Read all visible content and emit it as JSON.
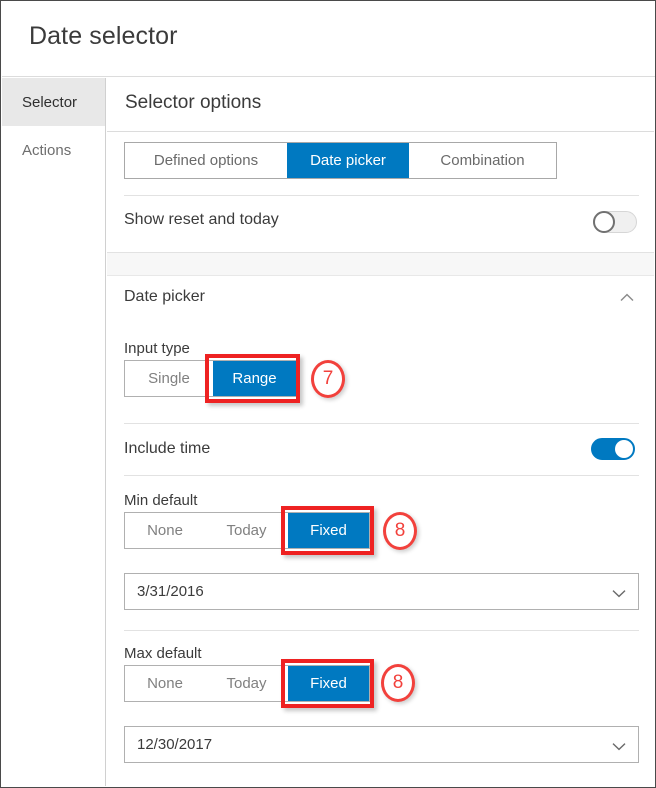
{
  "window": {
    "title": "Date selector"
  },
  "sidebar": {
    "items": [
      {
        "label": "Selector",
        "active": true
      },
      {
        "label": "Actions",
        "active": false
      }
    ]
  },
  "panel": {
    "header": "Selector options",
    "tabs": [
      {
        "label": "Defined options",
        "selected": false
      },
      {
        "label": "Date picker",
        "selected": true
      },
      {
        "label": "Combination",
        "selected": false
      }
    ],
    "show_reset_and_today": {
      "label": "Show reset and today",
      "value": "off"
    },
    "section": {
      "title": "Date picker",
      "collapse_icon": "chevron-up-icon",
      "expanded": true
    },
    "input_type": {
      "label": "Input type",
      "options": [
        "Single",
        "Range"
      ],
      "selected": "Range"
    },
    "include_time": {
      "label": "Include time",
      "value": "on"
    },
    "min_default": {
      "label": "Min default",
      "options": [
        "None",
        "Today",
        "Fixed"
      ],
      "selected": "Fixed",
      "date_value": "3/31/2016",
      "date_icon": "chevron-down-icon"
    },
    "max_default": {
      "label": "Max default",
      "options": [
        "None",
        "Today",
        "Fixed"
      ],
      "selected": "Fixed",
      "date_value": "12/30/2017",
      "date_icon": "chevron-down-icon"
    }
  },
  "annotations": [
    {
      "number": "7",
      "target": "input-type-range"
    },
    {
      "number": "8",
      "target": "min-default-fixed"
    },
    {
      "number": "8",
      "target": "max-default-fixed"
    }
  ],
  "colors": {
    "accent_blue": "#0079c1",
    "annotation_red": "#ee2222",
    "text": "#3b3b3b",
    "muted_text": "#808080",
    "border": "#b0b0b0"
  }
}
